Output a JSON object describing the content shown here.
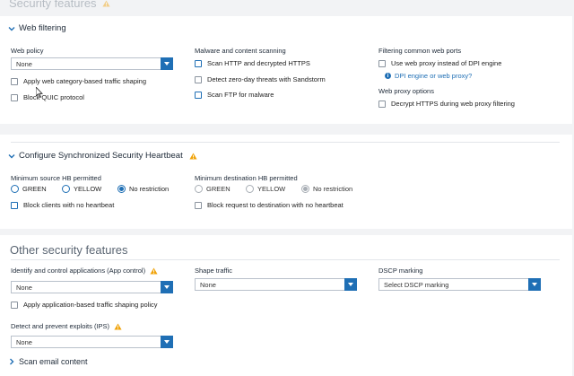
{
  "top_title": "Security features",
  "web_filtering": {
    "header": "Web filtering",
    "web_policy": {
      "label": "Web policy",
      "value": "None"
    },
    "apply_category_shaping": "Apply web category-based traffic shaping",
    "block_quic": "Block QUIC protocol",
    "malware": {
      "label": "Malware and content scanning",
      "scan_http": "Scan HTTP and decrypted HTTPS",
      "zero_day": "Detect zero-day threats with Sandstorm",
      "scan_ftp": "Scan FTP for malware"
    },
    "common_ports": {
      "label": "Filtering common web ports",
      "use_proxy": "Use web proxy instead of DPI engine",
      "link": "DPI engine or web proxy?"
    },
    "proxy_options": {
      "label": "Web proxy options",
      "decrypt": "Decrypt HTTPS during web proxy filtering"
    }
  },
  "heartbeat": {
    "header": "Configure Synchronized Security Heartbeat",
    "source_label": "Minimum source HB permitted",
    "source_options": [
      "GREEN",
      "YELLOW",
      "No restriction"
    ],
    "block_clients": "Block clients with no heartbeat",
    "dest_label": "Minimum destination HB permitted",
    "dest_options": [
      "GREEN",
      "YELLOW",
      "No restriction"
    ],
    "block_request": "Block request to destination with no heartbeat"
  },
  "other": {
    "title": "Other security features",
    "app_control": {
      "label": "Identify and control applications (App control)",
      "value": "None"
    },
    "apply_app_shaping": "Apply application-based traffic shaping policy",
    "shape_traffic": {
      "label": "Shape traffic",
      "value": "None"
    },
    "dscp": {
      "label": "DSCP marking",
      "value": "Select DSCP marking"
    },
    "ips": {
      "label": "Detect and prevent exploits (IPS)",
      "value": "None"
    },
    "scan_email": "Scan email content"
  },
  "colors": {
    "accent": "#1f6fb5",
    "warning": "#f0a30a"
  }
}
